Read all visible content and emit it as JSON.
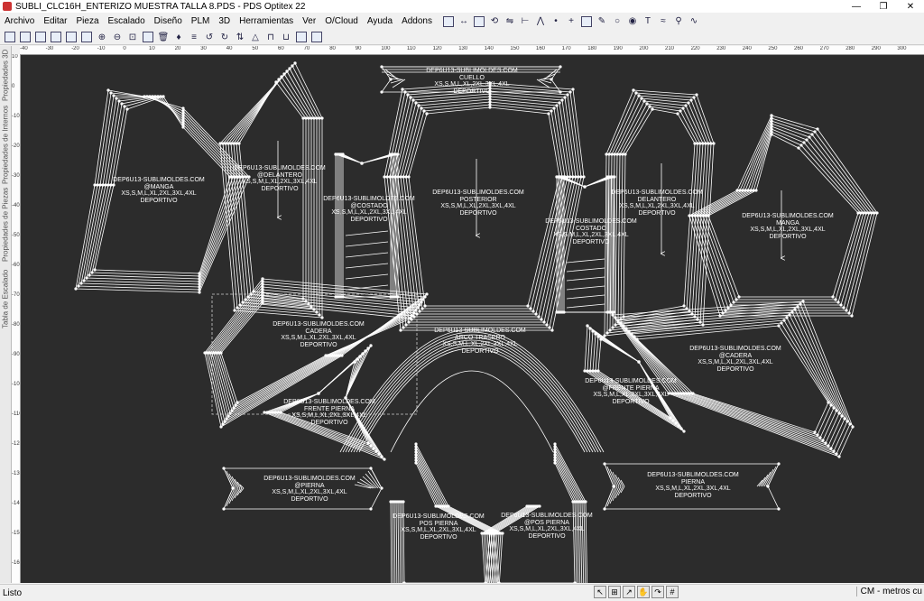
{
  "window": {
    "title": "SUBLI_CLC16H_ENTERIZO MUESTRA TALLA 8.PDS - PDS Optitex 22",
    "minimize": "—",
    "maximize": "❐",
    "close": "✕"
  },
  "menu": [
    "Archivo",
    "Editar",
    "Pieza",
    "Escalado",
    "Diseño",
    "PLM",
    "3D",
    "Herramientas",
    "Ver",
    "O/Cloud",
    "Ayuda",
    "Addons"
  ],
  "side_tabs": [
    "Propiedades 3D",
    "Propiedades de Internos",
    "Propiedades de Piezas",
    "Tabla de Escalado"
  ],
  "ruler_top": [
    "-40",
    "-30",
    "-20",
    "-10",
    "0",
    "10",
    "20",
    "30",
    "40",
    "50",
    "60",
    "70",
    "80",
    "90",
    "100",
    "110",
    "120",
    "130",
    "140",
    "150",
    "160",
    "170",
    "180",
    "190",
    "200",
    "210",
    "220",
    "230",
    "240",
    "250",
    "260",
    "270",
    "280",
    "290",
    "300"
  ],
  "ruler_left": [
    "10",
    "0",
    "-10",
    "-20",
    "-30",
    "-40",
    "-50",
    "-60",
    "-70",
    "-80",
    "-90",
    "-100",
    "-110",
    "-120",
    "-130",
    "-140",
    "-150",
    "-160"
  ],
  "pieces": {
    "cuello": {
      "line1": "DEP6U13-SUBLIMOLDES.COM",
      "line2": "CUELLO",
      "line3": "XS,S,M,L,XL,2XL,3XL,4XL",
      "line4": "DEPORTIVO"
    },
    "manga_left": {
      "line1": "DEP6U13-SUBLIMOLDES.COM",
      "line2": "@MANGA",
      "line3": "XS,S,M,L,XL,2XL,3XL,4XL",
      "line4": "DEPORTIVO"
    },
    "delantero_left": {
      "line1": "DEP6U13-SUBLIMOLDES.COM",
      "line2": "@DELANTERO",
      "line3": "XS,S,M,L,XL,2XL,3XL,4XL",
      "line4": "DEPORTIVO"
    },
    "costado_left": {
      "line1": "DEP6U13-SUBLIMOLDES.COM",
      "line2": "@COSTADO",
      "line3": "XS,S,M,L,XL,2XL,3XL,4XL",
      "line4": "DEPORTIVO"
    },
    "posterior": {
      "line1": "DEP6U13-SUBLIMOLDES.COM",
      "line2": "POSTERIOR",
      "line3": "XS,S,M,L,XL,2XL,3XL,4XL",
      "line4": "DEPORTIVO"
    },
    "costado_right": {
      "line1": "DEP6U13-SUBLIMOLDES.COM",
      "line2": "COSTADO",
      "line3": "XS,S,M,L,XL,2XL,3XL,4XL",
      "line4": "DEPORTIVO"
    },
    "delantero_right": {
      "line1": "DEP6U13-SUBLIMOLDES.COM",
      "line2": "DELANTERO",
      "line3": "XS,S,M,L,XL,2XL,3XL,4XL",
      "line4": "DEPORTIVO"
    },
    "manga_right": {
      "line1": "DEP6U13-SUBLIMOLDES.COM",
      "line2": "MANGA",
      "line3": "XS,S,M,L,XL,2XL,3XL,4XL",
      "line4": "DEPORTIVO"
    },
    "cadera_left": {
      "line1": "DEP6U13-SUBLIMOLDES.COM",
      "line2": "CADERA",
      "line3": "XS,S,M,L,XL,2XL,3XL,4XL",
      "line4": "DEPORTIVO"
    },
    "arco_trasero": {
      "line1": "DEP6U13-SUBLIMOLDES.COM",
      "line2": "ARCO TRASERO",
      "line3": "XS,S,M,L,XL,2XL,3XL,4XL",
      "line4": "DEPORTIVO"
    },
    "cadera_right": {
      "line1": "DEP6U13-SUBLIMOLDES.COM",
      "line2": "@CADERA",
      "line3": "XS,S,M,L,XL,2XL,3XL,4XL",
      "line4": "DEPORTIVO"
    },
    "frente_pierna_left": {
      "line1": "DEP6U13-SUBLIMOLDES.COM",
      "line2": "FRENTE PIERNA",
      "line3": "XS,S,M,L,XL,2XL,3XL,4XL",
      "line4": "DEPORTIVO"
    },
    "frente_pierna_right": {
      "line1": "DEP6U13-SUBLIMOLDES.COM",
      "line2": "@FRENTE PIERNA",
      "line3": "XS,S,M,L,XL,2XL,3XL,4XL",
      "line4": "DEPORTIVO"
    },
    "pierna_left": {
      "line1": "DEP6U13-SUBLIMOLDES.COM",
      "line2": "@PIERNA",
      "line3": "XS,S,M,L,XL,2XL,3XL,4XL",
      "line4": "DEPORTIVO"
    },
    "pierna_right": {
      "line1": "DEP6U13-SUBLIMOLDES.COM",
      "line2": "PIERNA",
      "line3": "XS,S,M,L,XL,2XL,3XL,4XL",
      "line4": "DEPORTIVO"
    },
    "pos_pierna_left": {
      "line1": "DEP6U13-SUBLIMOLDES.COM",
      "line2": "POS PIERNA",
      "line3": "XS,S,M,L,XL,2XL,3XL,4XL",
      "line4": "DEPORTIVO"
    },
    "pos_pierna_right": {
      "line1": "DEP6U13-SUBLIMOLDES.COM",
      "line2": "@POS PIERNA",
      "line3": "XS,S,M,L,XL,2XL,3XL,4XL",
      "line4": "DEPORTIVO"
    }
  },
  "status": {
    "text": "Listo",
    "units": "CM - metros cu"
  },
  "colors": {
    "canvas": "#2c2c2c",
    "piece_line": "#ffffff",
    "selection": "#cccccc"
  }
}
